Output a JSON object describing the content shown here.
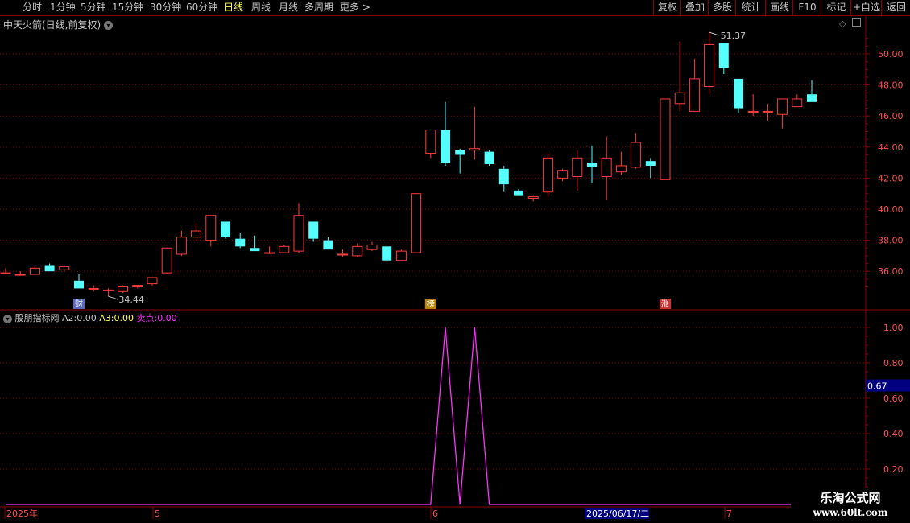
{
  "toolbar": {
    "periods": [
      {
        "label": "分时"
      },
      {
        "label": "1分钟"
      },
      {
        "label": "5分钟"
      },
      {
        "label": "15分钟"
      },
      {
        "label": "30分钟"
      },
      {
        "label": "60分钟"
      },
      {
        "label": "日线",
        "active": true
      },
      {
        "label": "周线"
      },
      {
        "label": "月线"
      },
      {
        "label": "多周期"
      },
      {
        "label": "更多 >"
      }
    ],
    "right_buttons": [
      {
        "label": "复权"
      },
      {
        "label": "叠加"
      },
      {
        "label": "多股"
      },
      {
        "label": "统计"
      },
      {
        "label": "画线"
      },
      {
        "label": "F10"
      },
      {
        "label": "标记"
      },
      {
        "label": "+自选"
      },
      {
        "label": "返回"
      }
    ]
  },
  "main_panel": {
    "title": "中天火箭(日线,前复权)",
    "price_ticks": [
      "50.00",
      "48.00",
      "46.00",
      "44.00",
      "42.00",
      "40.00",
      "38.00",
      "36.00"
    ],
    "max_label": "51.37",
    "min_label": "34.44",
    "markers": [
      "财",
      "榜",
      "涨"
    ]
  },
  "indicator_panel": {
    "name": "股朋指标网",
    "a2_label": "A2:",
    "a2_value": "0.00",
    "a3_label": "A3:",
    "a3_value": "0.00",
    "sell_label": "卖点:",
    "sell_value": "0.00",
    "ticks": [
      "1.00",
      "0.80",
      "0.60",
      "0.40",
      "0.20"
    ],
    "cursor_value": "0.67"
  },
  "date_axis": {
    "labels": [
      "2025年",
      "5",
      "6",
      "7"
    ],
    "cursor_date": "2025/06/17/二"
  },
  "colors": {
    "up": "#ff3c3c",
    "down": "#54ffff",
    "grid": "#8b0000",
    "indicator_line": "#ff32ff",
    "active_period": "#ffff54"
  },
  "watermark": {
    "line1": "乐淘公式网",
    "line2": "www.60lt.com"
  },
  "chart_data": {
    "type": "candlestick",
    "price_range": [
      35.0,
      51.8
    ],
    "candles": [
      [
        35.9,
        36.2,
        35.8,
        35.9
      ],
      [
        35.8,
        36.0,
        35.7,
        35.8
      ],
      [
        35.8,
        36.3,
        35.8,
        36.2
      ],
      [
        36.4,
        36.5,
        36.0,
        36.0
      ],
      [
        36.1,
        36.4,
        36.0,
        36.3
      ],
      [
        35.4,
        35.8,
        34.9,
        34.9
      ],
      [
        34.9,
        35.1,
        34.7,
        34.9
      ],
      [
        34.8,
        34.9,
        34.4,
        34.8
      ],
      [
        34.7,
        35.1,
        34.6,
        35.0
      ],
      [
        35.0,
        35.1,
        34.9,
        35.1
      ],
      [
        35.2,
        35.6,
        35.1,
        35.6
      ],
      [
        35.9,
        37.5,
        35.8,
        37.5
      ],
      [
        37.1,
        38.6,
        37.0,
        38.2
      ],
      [
        38.2,
        39.1,
        38.0,
        38.6
      ],
      [
        38.0,
        39.6,
        37.6,
        39.6
      ],
      [
        39.2,
        39.2,
        38.1,
        38.2
      ],
      [
        38.1,
        38.5,
        37.5,
        37.6
      ],
      [
        37.5,
        38.3,
        37.3,
        37.3
      ],
      [
        37.2,
        37.6,
        37.1,
        37.2
      ],
      [
        37.2,
        37.7,
        37.2,
        37.6
      ],
      [
        37.3,
        40.4,
        37.2,
        39.6
      ],
      [
        39.2,
        39.2,
        37.9,
        38.1
      ],
      [
        38.0,
        38.2,
        37.4,
        37.4
      ],
      [
        37.1,
        37.4,
        36.9,
        37.1
      ],
      [
        37.0,
        37.8,
        36.9,
        37.6
      ],
      [
        37.4,
        37.9,
        37.3,
        37.7
      ],
      [
        37.6,
        37.6,
        36.7,
        36.7
      ],
      [
        36.7,
        37.4,
        36.7,
        37.3
      ],
      [
        37.2,
        41.0,
        37.2,
        41.0
      ],
      [
        43.6,
        45.1,
        43.3,
        45.1
      ],
      [
        45.1,
        46.9,
        42.8,
        43.0
      ],
      [
        43.8,
        43.9,
        42.3,
        43.5
      ],
      [
        43.8,
        46.6,
        43.2,
        43.9
      ],
      [
        43.7,
        43.8,
        42.8,
        42.9
      ],
      [
        42.6,
        42.8,
        41.1,
        41.6
      ],
      [
        41.2,
        41.3,
        40.9,
        40.9
      ],
      [
        40.7,
        40.9,
        40.5,
        40.8
      ],
      [
        41.1,
        43.6,
        40.8,
        43.3
      ],
      [
        42.0,
        42.6,
        41.8,
        42.5
      ],
      [
        42.1,
        43.8,
        41.2,
        43.3
      ],
      [
        43.0,
        44.1,
        41.7,
        42.7
      ],
      [
        42.1,
        44.7,
        40.6,
        43.3
      ],
      [
        42.4,
        43.7,
        42.2,
        42.8
      ],
      [
        42.7,
        44.9,
        42.6,
        44.3
      ],
      [
        43.1,
        43.3,
        42.0,
        42.8
      ],
      [
        41.9,
        47.1,
        41.9,
        47.1
      ],
      [
        46.8,
        50.8,
        46.3,
        47.5
      ],
      [
        46.3,
        49.7,
        46.3,
        48.4
      ],
      [
        47.9,
        51.4,
        47.4,
        50.6
      ],
      [
        50.7,
        50.7,
        48.7,
        49.1
      ],
      [
        48.4,
        48.4,
        46.2,
        46.5
      ],
      [
        46.3,
        47.4,
        46.0,
        46.3
      ],
      [
        46.3,
        46.8,
        45.7,
        46.3
      ],
      [
        46.1,
        47.1,
        45.2,
        47.1
      ],
      [
        46.6,
        47.4,
        46.6,
        47.1
      ],
      [
        47.4,
        48.3,
        46.9,
        46.9
      ]
    ],
    "indicator": {
      "name": "卖点",
      "range": [
        0,
        1.1
      ],
      "values": [
        0,
        0,
        0,
        0,
        0,
        0,
        0,
        0,
        0,
        0,
        0,
        0,
        0,
        0,
        0,
        0,
        0,
        0,
        0,
        0,
        0,
        0,
        0,
        0,
        0,
        0,
        0,
        0,
        0,
        0,
        1,
        0,
        1,
        0,
        0,
        0,
        0,
        0,
        0,
        0,
        0,
        0,
        0,
        0,
        0,
        0,
        0,
        0,
        0,
        0,
        0,
        0,
        0,
        0,
        0,
        0
      ]
    }
  }
}
